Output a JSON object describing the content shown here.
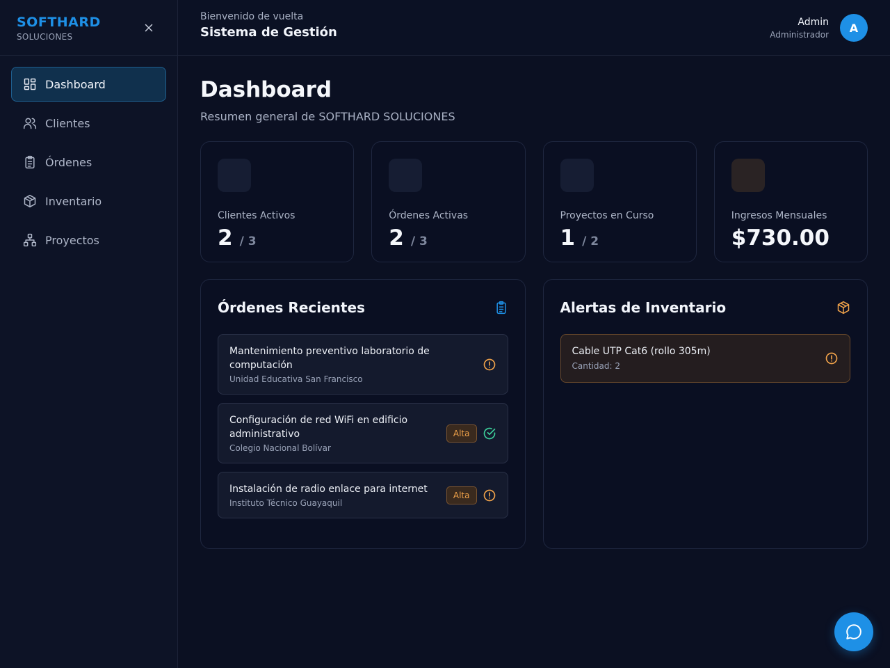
{
  "brand": {
    "name": "SOFTHARD",
    "sub": "SOLUCIONES"
  },
  "nav": [
    {
      "label": "Dashboard",
      "icon": "dashboard-icon",
      "active": true
    },
    {
      "label": "Clientes",
      "icon": "users-icon"
    },
    {
      "label": "Órdenes",
      "icon": "clipboard-icon"
    },
    {
      "label": "Inventario",
      "icon": "box-icon"
    },
    {
      "label": "Proyectos",
      "icon": "network-icon"
    }
  ],
  "header": {
    "welcome": "Bienvenido de vuelta",
    "title": "Sistema de Gestión"
  },
  "user": {
    "name": "Admin",
    "role": "Administrador",
    "initial": "A"
  },
  "page": {
    "title": "Dashboard",
    "subtitle": "Resumen general de SOFTHARD SOLUCIONES"
  },
  "stats": [
    {
      "label": "Clientes Activos",
      "value": "2",
      "total": "/ 3"
    },
    {
      "label": "Órdenes Activas",
      "value": "2",
      "total": "/ 3"
    },
    {
      "label": "Proyectos en Curso",
      "value": "1",
      "total": "/ 2"
    },
    {
      "label": "Ingresos Mensuales",
      "value": "$730.00",
      "total": ""
    }
  ],
  "orders": {
    "title": "Órdenes Recientes",
    "items": [
      {
        "title": "Mantenimiento preventivo laboratorio de computación",
        "client": "Unidad Educativa San Francisco",
        "badge": "",
        "status_icon": "alert-circle-icon"
      },
      {
        "title": "Configuración de red WiFi en edificio administrativo",
        "client": "Colegio Nacional Bolívar",
        "badge": "Alta",
        "status_icon": "check-circle-icon"
      },
      {
        "title": "Instalación de radio enlace para internet",
        "client": "Instituto Técnico Guayaquil",
        "badge": "Alta",
        "status_icon": "alert-circle-icon"
      }
    ]
  },
  "inventory": {
    "title": "Alertas de Inventario",
    "items": [
      {
        "title": "Cable UTP Cat6 (rollo 305m)",
        "qty": "Cantidad: 2"
      }
    ]
  },
  "colors": {
    "accent": "#1e90e6",
    "warning": "#f0a24a",
    "success": "#3ccf9a"
  }
}
